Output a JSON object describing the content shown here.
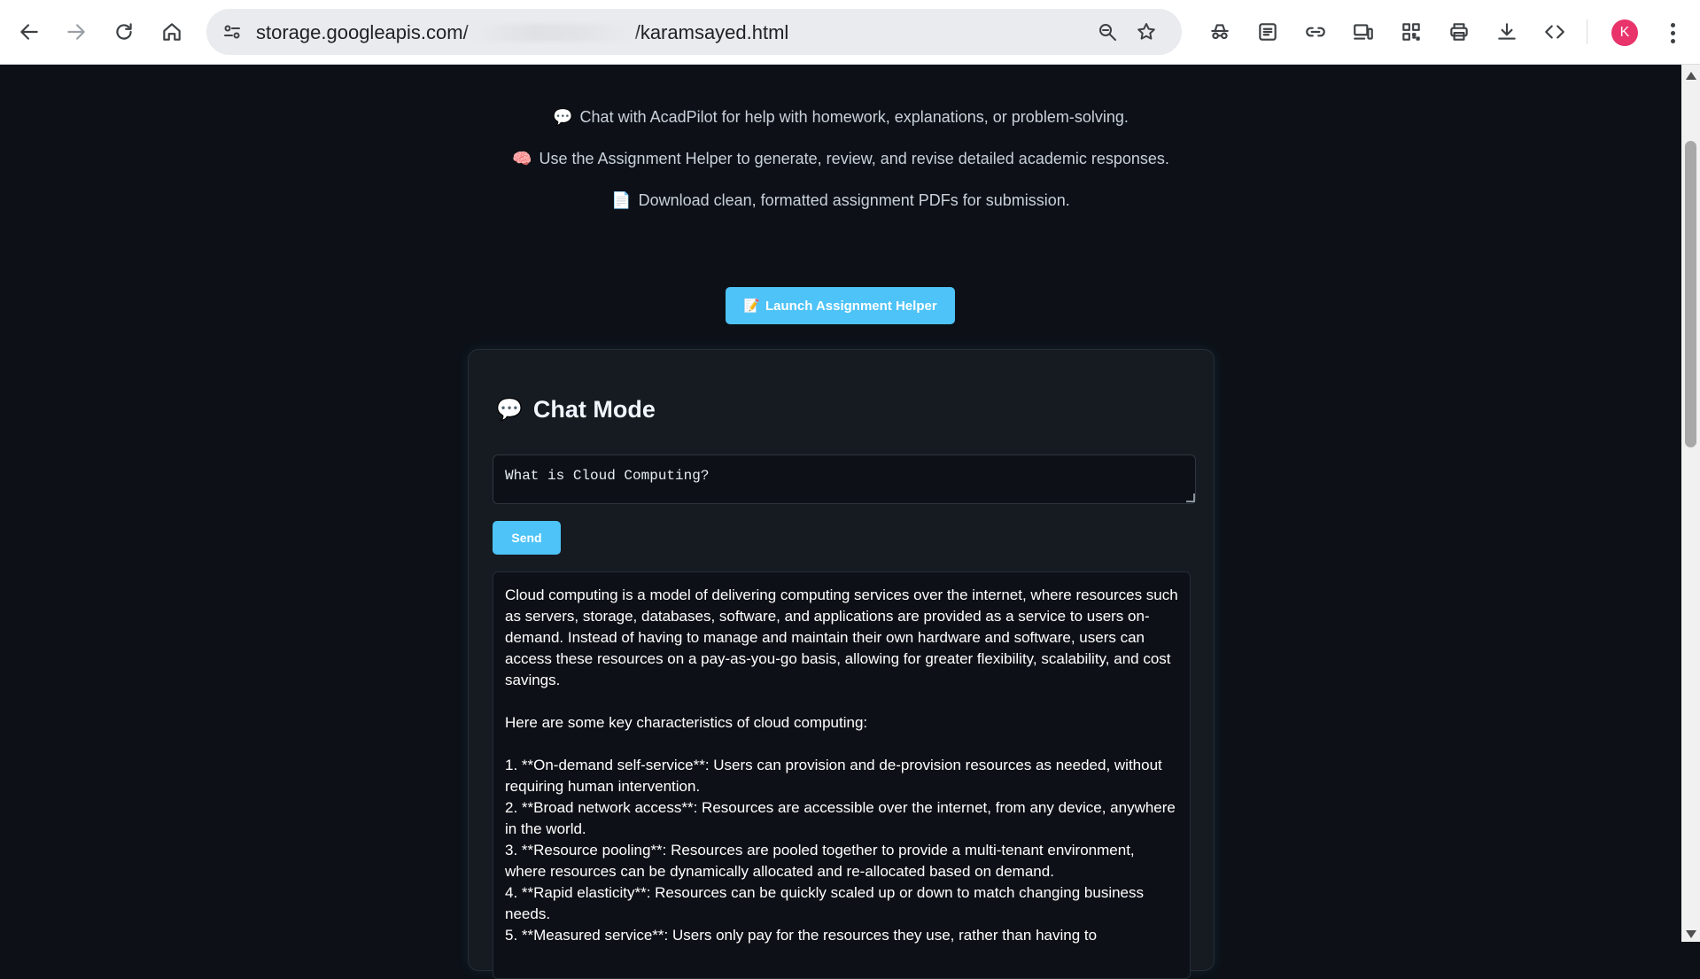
{
  "browser": {
    "url_prefix": "storage.googleapis.com/",
    "url_suffix": "/karamsayed.html",
    "profile_initial": "K"
  },
  "intro": {
    "line1_emoji": "💬",
    "line1": "Chat with AcadPilot for help with homework, explanations, or problem-solving.",
    "line2_emoji": "🧠",
    "line2": "Use the Assignment Helper to generate, review, and revise detailed academic responses.",
    "line3_emoji": "📄",
    "line3": "Download clean, formatted assignment PDFs for submission."
  },
  "launch_button": {
    "emoji": "📝",
    "label": "Launch Assignment Helper"
  },
  "chat": {
    "title_emoji": "💬",
    "title": "Chat Mode",
    "input_value": "What is Cloud Computing?",
    "send_label": "Send",
    "response": "Cloud computing is a model of delivering computing services over the internet, where resources such as servers, storage, databases, software, and applications are provided as a service to users on-demand. Instead of having to manage and maintain their own hardware and software, users can access these resources on a pay-as-you-go basis, allowing for greater flexibility, scalability, and cost savings.\n\nHere are some key characteristics of cloud computing:\n\n1. **On-demand self-service**: Users can provision and de-provision resources as needed, without requiring human intervention.\n2. **Broad network access**: Resources are accessible over the internet, from any device, anywhere in the world.\n3. **Resource pooling**: Resources are pooled together to provide a multi-tenant environment, where resources can be dynamically allocated and re-allocated based on demand.\n4. **Rapid elasticity**: Resources can be quickly scaled up or down to match changing business needs.\n5. **Measured service**: Users only pay for the resources they use, rather than having to"
  },
  "colors": {
    "page_bg": "#0d1117",
    "card_bg": "#161b22",
    "accent": "#4dc3f7",
    "avatar": "#e8336b"
  }
}
